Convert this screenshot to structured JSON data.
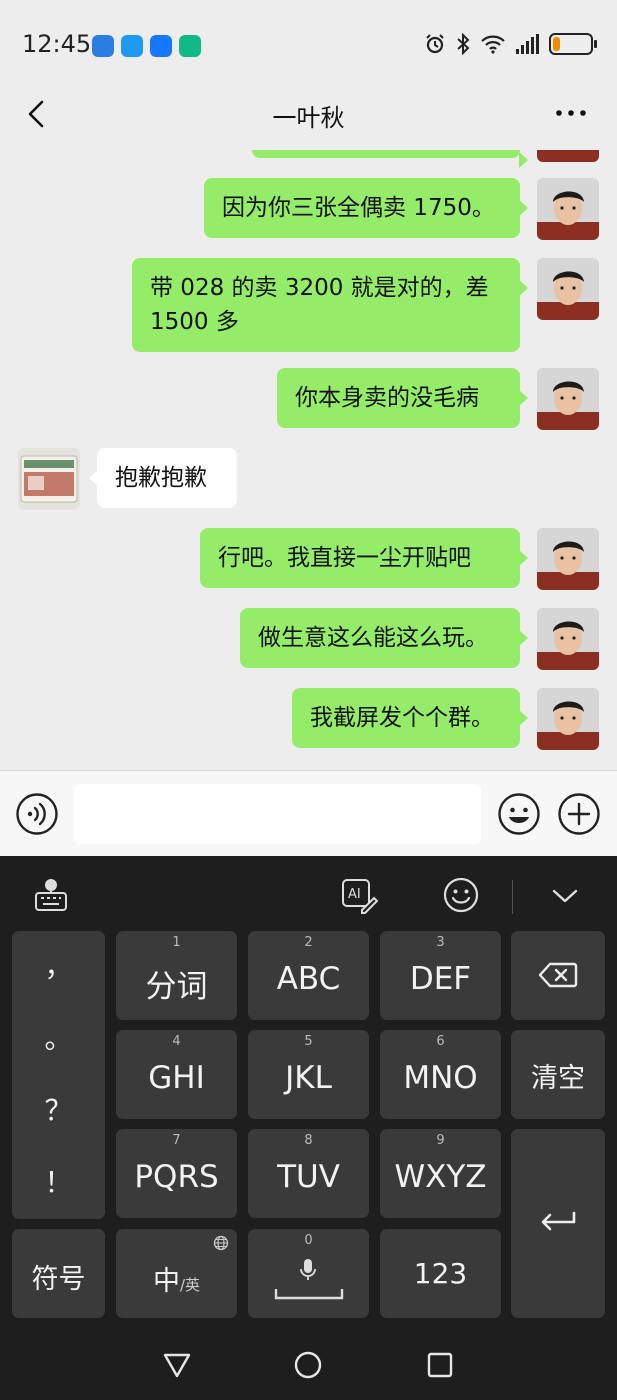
{
  "status_bar": {
    "time": "12:45",
    "notifications": [
      {
        "icon": "app-blue-icon",
        "color": "#2a7de1"
      },
      {
        "icon": "chat-bubble-icon",
        "color": "#1e9bf0"
      },
      {
        "icon": "alipay-icon",
        "color": "#1677ff"
      },
      {
        "icon": "app-green-icon",
        "color": "#12b886"
      }
    ],
    "status_icons": [
      "alarm-icon",
      "bluetooth-icon",
      "wifi-icon",
      "signal-icon",
      "battery-icon"
    ],
    "battery_level": 0.2,
    "battery_color": "#f08c00"
  },
  "header": {
    "title": "一叶秋"
  },
  "messages": [
    {
      "side": "mine",
      "text": ""
    },
    {
      "side": "mine",
      "text": "因为你三张全偶卖 1750。"
    },
    {
      "side": "mine",
      "text": "带 028 的卖 3200 就是对的，差 1500 多"
    },
    {
      "side": "mine",
      "text": "你本身卖的没毛病"
    },
    {
      "side": "theirs",
      "text": "抱歉抱歉"
    },
    {
      "side": "mine",
      "text": "行吧。我直接一尘开贴吧"
    },
    {
      "side": "mine",
      "text": "做生意这么能这么玩。"
    },
    {
      "side": "mine",
      "text": "我截屏发个个群。"
    }
  ],
  "input": {
    "value": "",
    "placeholder": ""
  },
  "keyboard": {
    "punctuation": [
      "，",
      "。",
      "？",
      "！"
    ],
    "keys": [
      {
        "num": "1",
        "label": "分词"
      },
      {
        "num": "2",
        "label": "ABC"
      },
      {
        "num": "3",
        "label": "DEF"
      },
      {
        "num": "4",
        "label": "GHI"
      },
      {
        "num": "5",
        "label": "JKL"
      },
      {
        "num": "6",
        "label": "MNO"
      },
      {
        "num": "7",
        "label": "PQRS"
      },
      {
        "num": "8",
        "label": "TUV"
      },
      {
        "num": "9",
        "label": "WXYZ"
      }
    ],
    "clear_label": "清空",
    "symbols_label": "符号",
    "lang_main": "中",
    "lang_sub": "/英",
    "space_num": "0",
    "numbers_label": "123"
  },
  "colors": {
    "my_bubble": "#95ec69",
    "their_bubble": "#ffffff",
    "chat_bg": "#ededed",
    "keyboard_bg": "#1e1e1e",
    "key_bg": "#3a3a3a"
  }
}
